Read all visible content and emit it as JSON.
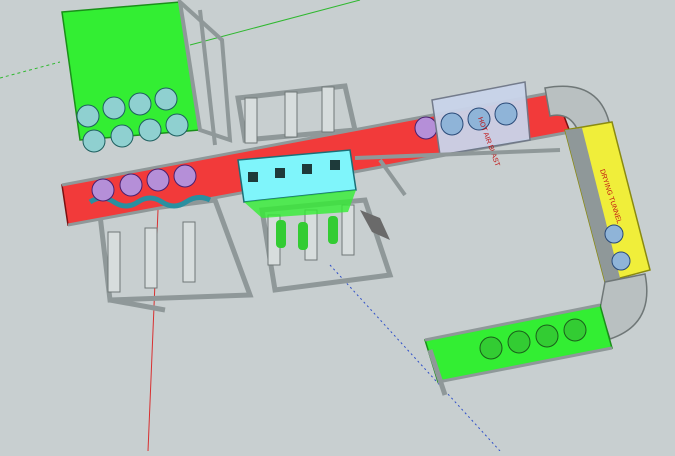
{
  "scene": {
    "background_color": "#c8cfd0",
    "colors": {
      "green": "#33ee33",
      "red": "#f23a3a",
      "cyan": "#7ff5fb",
      "yellow": "#f0ee3a",
      "frame": "#8f9899",
      "glass": "#c9d4ea",
      "bottle_blue": "#8fb4d8",
      "bottle_purple": "#b58fd8",
      "axis_red": "#d83030",
      "axis_green": "#2fb82f",
      "axis_blue": "#3050c8"
    },
    "labels": {
      "hot_air_zone": "HOT AIR BLAST",
      "drying_tunnel": "DRYING TUNNEL"
    }
  }
}
